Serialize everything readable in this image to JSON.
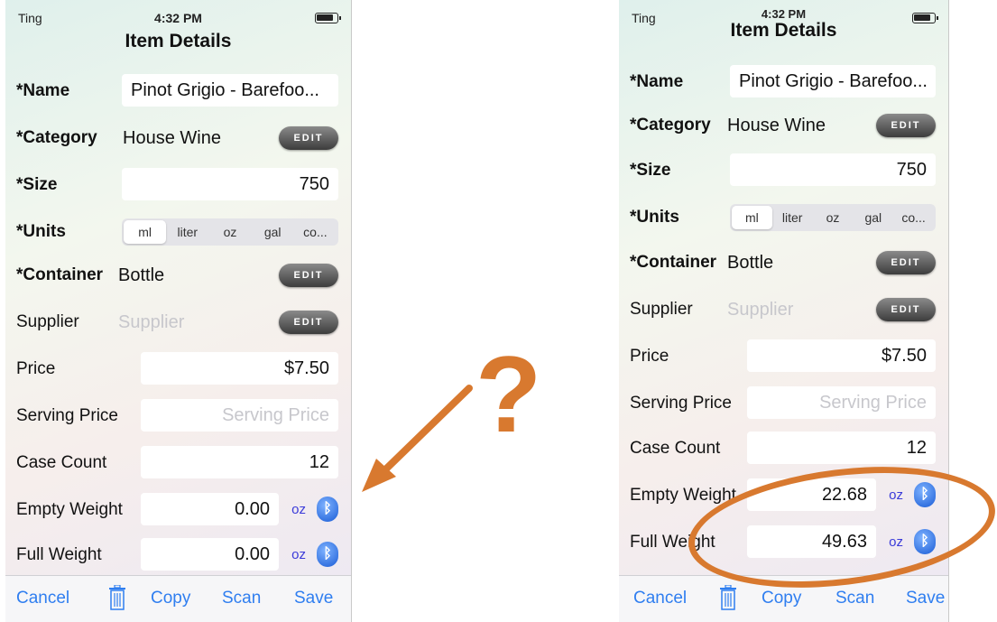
{
  "status": {
    "carrier": "Ting",
    "time": "4:32 PM"
  },
  "screen_title": "Item Details",
  "left": {
    "name": {
      "label": "*Name",
      "value": "Pinot Grigio - Barefoo..."
    },
    "category": {
      "label": "*Category",
      "value": "House Wine",
      "edit": "EDIT"
    },
    "size": {
      "label": "*Size",
      "value": "750"
    },
    "units": {
      "label": "*Units",
      "options": [
        "ml",
        "liter",
        "oz",
        "gal",
        "co..."
      ],
      "selected": "ml"
    },
    "container": {
      "label": "*Container",
      "value": "Bottle",
      "edit": "EDIT"
    },
    "supplier": {
      "label": "Supplier",
      "placeholder": "Supplier",
      "edit": "EDIT"
    },
    "price": {
      "label": "Price",
      "value": "$7.50"
    },
    "serving_price": {
      "label": "Serving Price",
      "placeholder": "Serving Price"
    },
    "case_count": {
      "label": "Case Count",
      "value": "12"
    },
    "empty_weight": {
      "label": "Empty Weight",
      "value": "0.00",
      "unit": "oz"
    },
    "full_weight": {
      "label": "Full Weight",
      "value": "0.00",
      "unit": "oz"
    }
  },
  "right": {
    "name": {
      "label": "*Name",
      "value": "Pinot Grigio - Barefoo..."
    },
    "category": {
      "label": "*Category",
      "value": "House Wine",
      "edit": "EDIT"
    },
    "size": {
      "label": "*Size",
      "value": "750"
    },
    "units": {
      "label": "*Units",
      "options": [
        "ml",
        "liter",
        "oz",
        "gal",
        "co..."
      ],
      "selected": "ml"
    },
    "container": {
      "label": "*Container",
      "value": "Bottle",
      "edit": "EDIT"
    },
    "supplier": {
      "label": "Supplier",
      "placeholder": "Supplier",
      "edit": "EDIT"
    },
    "price": {
      "label": "Price",
      "value": "$7.50"
    },
    "serving_price": {
      "label": "Serving Price",
      "placeholder": "Serving Price"
    },
    "case_count": {
      "label": "Case Count",
      "value": "12"
    },
    "empty_weight": {
      "label": "Empty Weight",
      "value": "22.68",
      "unit": "oz"
    },
    "full_weight": {
      "label": "Full Weight",
      "value": "49.63",
      "unit": "oz"
    }
  },
  "toolbar": {
    "cancel": "Cancel",
    "copy": "Copy",
    "scan": "Scan",
    "save": "Save"
  },
  "annotation": {
    "symbol": "?",
    "color": "#d8792f"
  },
  "colors": {
    "link_blue": "#2f7ef0",
    "unit_blue": "#3b3bd9",
    "bluetooth_blue": "#1a5cd6",
    "annotation_orange": "#d8792f"
  },
  "icons": {
    "trash": "trash-icon",
    "bluetooth": "bluetooth-icon",
    "arrow": "arrow-icon"
  }
}
